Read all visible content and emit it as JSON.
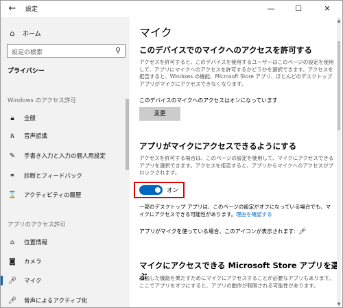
{
  "titlebar": {
    "back": "←",
    "title": "設定",
    "minimize": "—",
    "maximize": "☐",
    "close": "✕"
  },
  "sidebar": {
    "home_label": "ホーム",
    "search_placeholder": "設定の検索",
    "privacy_label": "プライバシー",
    "section_windows": "Windows のアクセス許可",
    "windows_items": [
      {
        "label": "全般",
        "icon": "lock-icon"
      },
      {
        "label": "音声認識",
        "icon": "speech-icon"
      },
      {
        "label": "手書き入力と入力の個人用設定",
        "icon": "pen-icon"
      },
      {
        "label": "診断とフィードバック",
        "icon": "feedback-icon"
      },
      {
        "label": "アクティビティの履歴",
        "icon": "activity-icon"
      }
    ],
    "section_apps": "アプリのアクセス許可",
    "app_items": [
      {
        "label": "位置情報",
        "icon": "location-icon"
      },
      {
        "label": "カメラ",
        "icon": "camera-icon"
      },
      {
        "label": "マイク",
        "icon": "microphone-icon",
        "active": true
      },
      {
        "label": "音声によるアクティブ化",
        "icon": "microphone-icon"
      }
    ],
    "accent_color": "#0067c0"
  },
  "content": {
    "page_title": "マイク",
    "section1": {
      "heading": "このデバイスでのマイクへのアクセスを許可する",
      "description": "アクセスを許可すると、このデバイスを使用するユーザーはこのページの設定を使用して、アプリにマイクへのアクセスを許可するかどうかを選択できます。アクセスを拒否すると、Windows の機能、Microsoft Store アプリ、ほとんどのデスクトップ アプリがマイクにアクセスできなくなります。",
      "status": "このデバイスのマイクへのアクセスはオンになっています",
      "change_button": "変更"
    },
    "section2": {
      "heading": "アプリがマイクにアクセスできるようにする",
      "description": "アクセスを許可する場合は、このページの設定を使用して、マイクにアクセスできるアプリを選択できます。アクセスを拒否すると、アプリからマイクへのアクセスがブロックされます。",
      "toggle_label": "オン",
      "toggle_on": true,
      "note_text": "一部のデスクトップ アプリは、このページの設定がオフになっている場合でも、マイクにアクセスできる可能性があります。",
      "note_link": "理由を確認する",
      "indicator_text": "アプリがマイクを使っている場合、このアイコンが表示されます:"
    },
    "section3": {
      "heading": "マイクにアクセスできる Microsoft Store アプリを選ぶ",
      "description": "意図した機能を果たすためにマイクにアクセスすることが必要なアプリもあります。ここでアプリをオフにすると、アプリの動作が制限される可能性があります。"
    }
  }
}
